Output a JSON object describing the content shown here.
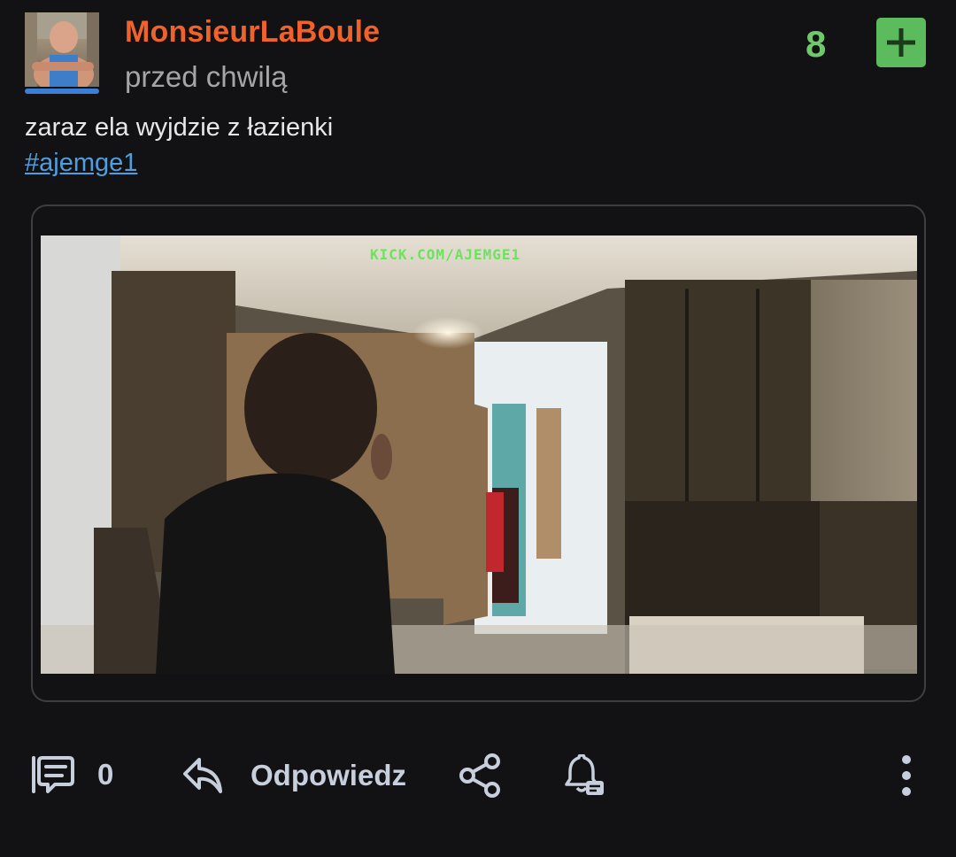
{
  "post": {
    "author": "MonsieurLaBoule",
    "timestamp": "przed chwilą",
    "votes": "8",
    "vote_icon": "plus-icon",
    "text": "zaraz ela wyjdzie z łazienki",
    "hashtag": "#ajemge1"
  },
  "media": {
    "watermark": "KICK.COM/AJEMGE1"
  },
  "actions": {
    "comments_count": "0",
    "reply_label": "Odpowiedz",
    "icons": [
      "comments-icon",
      "reply-icon",
      "share-icon",
      "notification-icon",
      "more-icon"
    ]
  },
  "colors": {
    "username": "#f0622b",
    "votes": "#6fc86a",
    "vote_button": "#5cbb5d",
    "hashtag": "#4f9fe0",
    "action_icons": "#c7cfdc",
    "background": "#121214"
  }
}
